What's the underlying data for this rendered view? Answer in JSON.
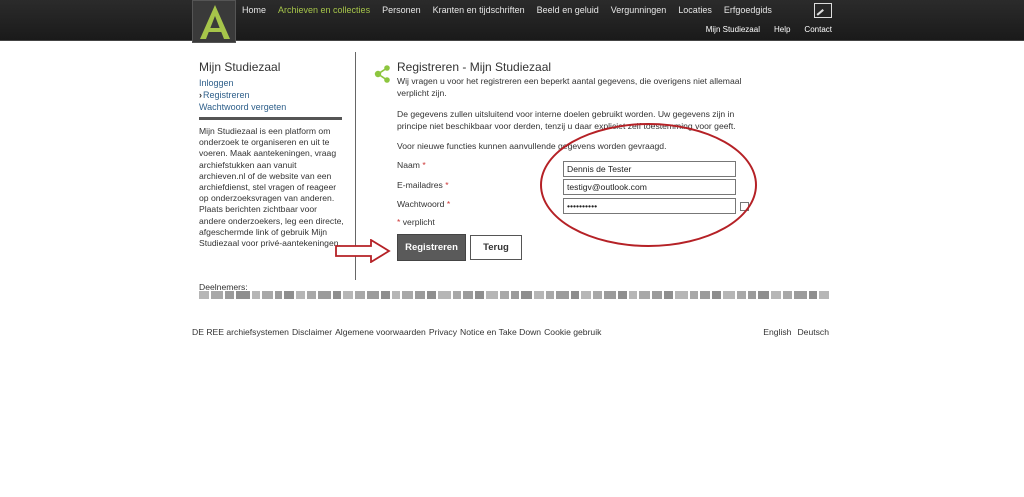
{
  "header": {
    "logo_letter": "A",
    "main_nav": [
      "Home",
      "Archieven en collecties",
      "Personen",
      "Kranten en tijdschriften",
      "Beeld en geluid",
      "Vergunningen",
      "Locaties",
      "Erfgoedgids"
    ],
    "active_nav_index": 1,
    "sub_nav": [
      "Mijn Studiezaal",
      "Help",
      "Contact"
    ],
    "accent_color": "#a6c54a"
  },
  "sidebar": {
    "title": "Mijn Studiezaal",
    "links": [
      "Inloggen",
      "Registreren",
      "Wachtwoord vergeten"
    ],
    "current_link_index": 1,
    "description": "Mijn Studiezaal is een platform om onderzoek te organiseren en uit te voeren. Maak aantekeningen, vraag archiefstukken aan vanuit archieven.nl of de website van een archiefdienst, stel vragen of reageer op onderzoeksvragen van anderen. Plaats berichten zichtbaar voor andere onderzoekers, leg een directe, afgeschermde link of gebruik Mijn Studiezaal voor privé-aantekeningen."
  },
  "form": {
    "title": "Registreren - Mijn Studiezaal",
    "intro": "Wij vragen u voor het registreren een beperkt aantal gegevens, die overigens niet allemaal verplicht zijn.",
    "privacy": "De gegevens zullen uitsluitend voor interne doelen gebruikt worden. Uw gegevens zijn in principe niet beschikbaar voor derden, tenzij u daar expliciet zelf toestemming voor geeft.",
    "note": "Voor nieuwe functies kunnen aanvullende gegevens worden gevraagd.",
    "name_label": "Naam",
    "name_value": "Dennis de Tester",
    "email_label": "E-mailadres",
    "email_value": "testigv@outlook.com",
    "password_label": "Wachtwoord",
    "password_value": "••••••••••",
    "required_marker": "*",
    "required_note": "verplicht",
    "submit_label": "Registreren",
    "back_label": "Terug"
  },
  "partners": {
    "label": "Deelnemers:"
  },
  "footer": {
    "links": [
      "DE REE archiefsystemen",
      "Disclaimer",
      "Algemene voorwaarden",
      "Privacy",
      "Notice en Take Down",
      "Cookie gebruik"
    ],
    "languages": [
      "English",
      "Deutsch"
    ]
  },
  "annotation_color": "#b52126"
}
